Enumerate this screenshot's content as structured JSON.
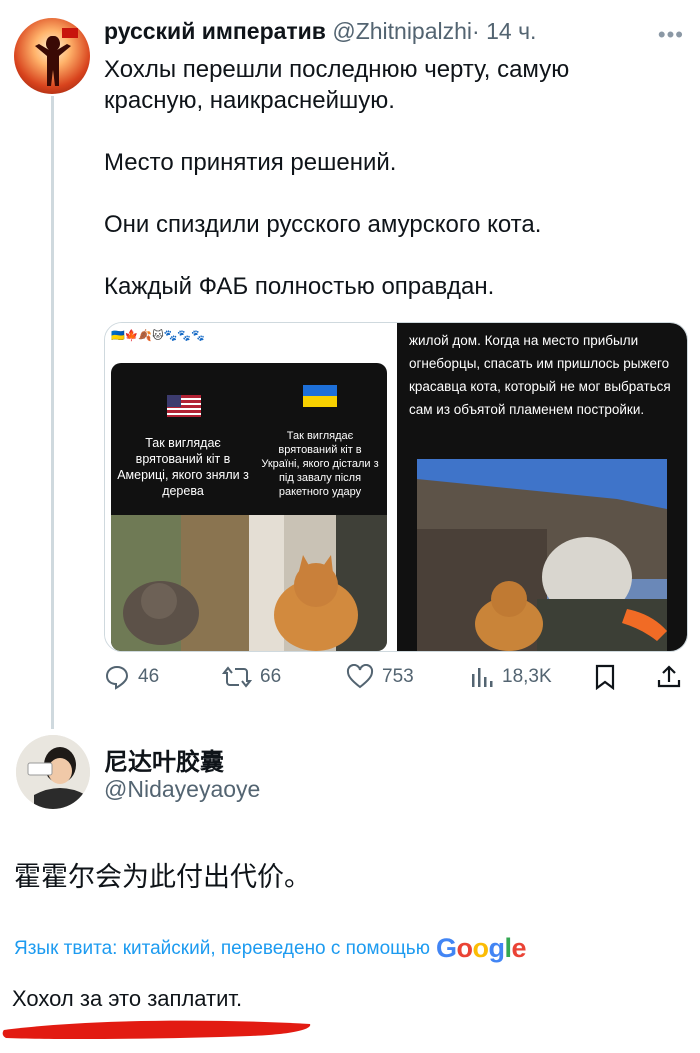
{
  "tweet": {
    "author_name": "русский императив",
    "handle": "@Zhitnipalzhi",
    "separator": "·",
    "time": "14 ч.",
    "more_icon": "more-dots-icon",
    "paragraphs": [
      "Хохлы перешли последнюю черту, самую красную, наикраснейшую.",
      "Место принятия решений.",
      "Они спиздили русского амурского кота.",
      "Каждый ФАБ полностью оправдан."
    ],
    "media": {
      "emoji_row": "🇺🇦🍁🍂🐱🐾🐾🐾",
      "left_caption_us": "Так виглядає врятований кіт в Америці, якого зняли з дерева",
      "left_caption_ua": "Так виглядає врятований кіт в Україні, якого дістали з під завалу після ракетного удару",
      "right_text": "жилой дом. Когда на место прибыли огнеборцы, спасать им пришлось рыжего красавца кота, который не мог выбраться сам из объятой пламенем постройки."
    },
    "actions": {
      "replies": "46",
      "retweets": "66",
      "likes": "753",
      "views": "18,3K"
    }
  },
  "reply": {
    "author_name": "尼达叶胶囊",
    "handle": "@Nidayeyaoye",
    "text": "霍霍尔会为此付出代价。",
    "translation_label": "Язык твита: китайский, переведено с помощью",
    "translation_brand": "Google",
    "translated_text": "Хохол за это заплатит."
  },
  "colors": {
    "text": "#0f1419",
    "secondary": "#536471",
    "link": "#1d9bf0",
    "annotation_red": "#e21b12"
  }
}
